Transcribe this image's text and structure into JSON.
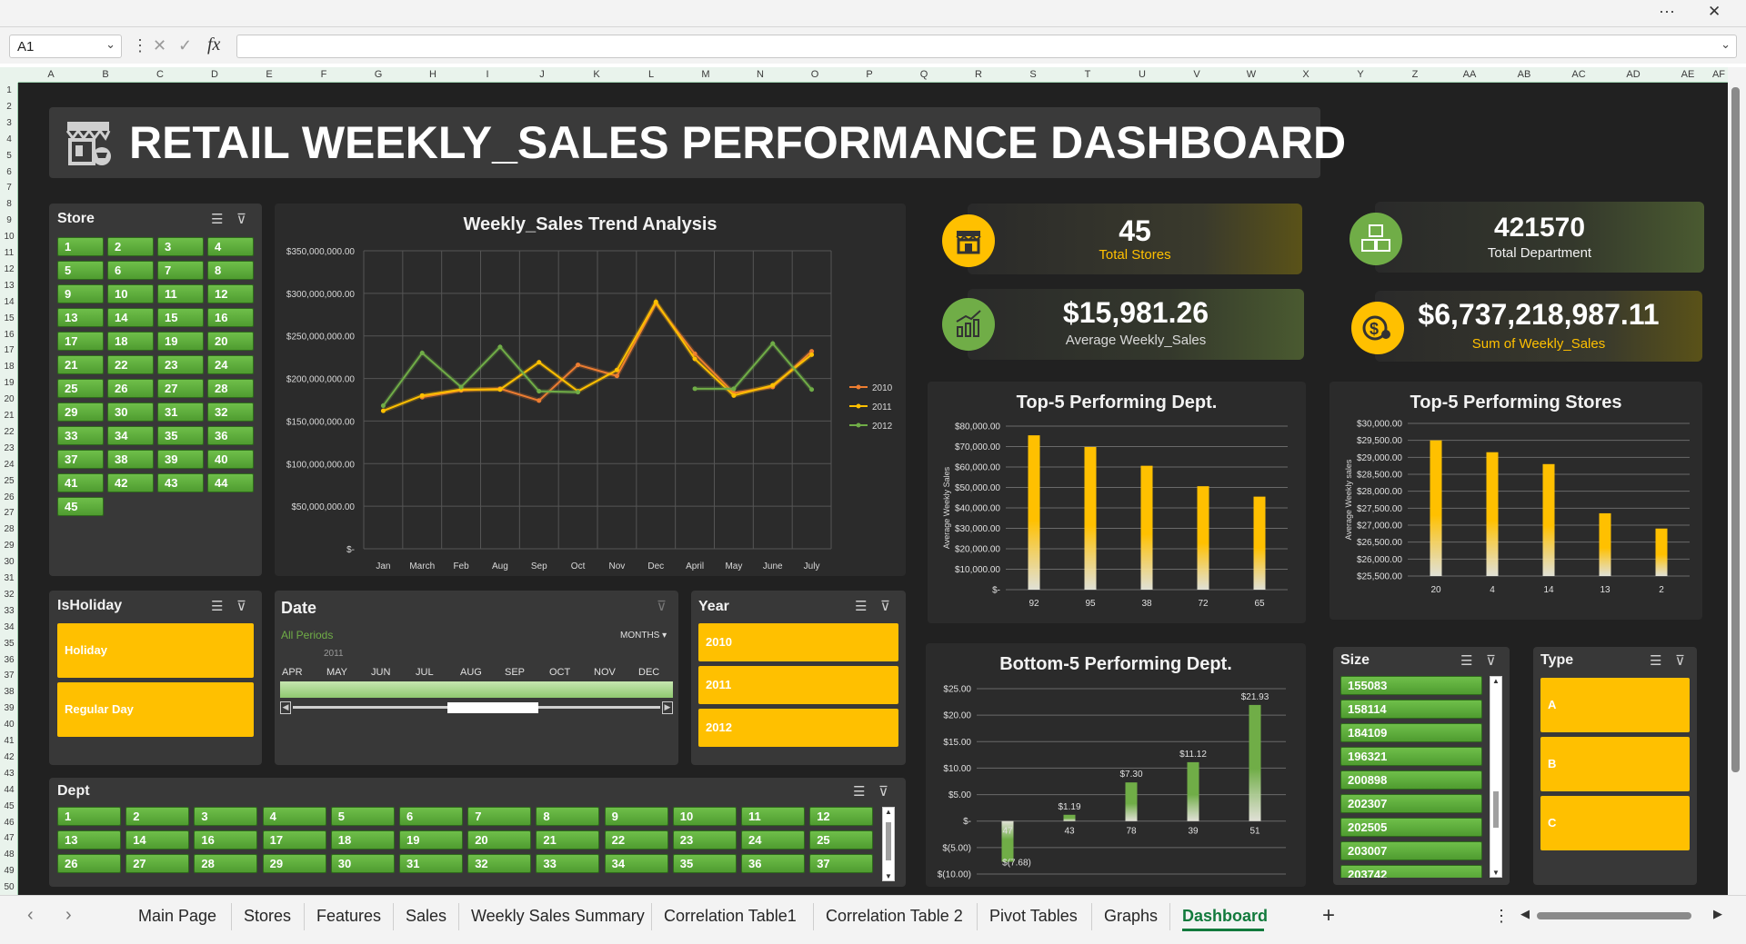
{
  "window": {
    "more_label": "···",
    "close_label": "✕"
  },
  "formula": {
    "cell_ref": "A1",
    "cancel_label": "✕",
    "enter_label": "✓",
    "fx_label": "fx",
    "value": ""
  },
  "columns": [
    "A",
    "B",
    "C",
    "D",
    "E",
    "F",
    "G",
    "H",
    "I",
    "J",
    "K",
    "L",
    "M",
    "N",
    "O",
    "P",
    "Q",
    "R",
    "S",
    "T",
    "U",
    "V",
    "W",
    "X",
    "Y",
    "Z",
    "AA",
    "AB",
    "AC",
    "AD",
    "AE",
    "AF"
  ],
  "rows": [
    "1",
    "2",
    "3",
    "4",
    "5",
    "6",
    "7",
    "8",
    "9",
    "10",
    "11",
    "12",
    "13",
    "14",
    "15",
    "16",
    "17",
    "18",
    "19",
    "20",
    "21",
    "22",
    "23",
    "24",
    "25",
    "26",
    "27",
    "28",
    "29",
    "30",
    "31",
    "32",
    "33",
    "34",
    "35",
    "36",
    "37",
    "38",
    "39",
    "40",
    "41",
    "42",
    "43",
    "44",
    "45",
    "46",
    "47",
    "48",
    "49",
    "50"
  ],
  "dashboard": {
    "title": "RETAIL WEEKLY_SALES PERFORMANCE DASHBOARD",
    "kpis": [
      {
        "value": "45",
        "label": "Total Stores",
        "label_color": "#ffc000"
      },
      {
        "value": "421570",
        "label": "Total Department",
        "label_color": "#f2f2f2"
      },
      {
        "value": "$15,981.26",
        "label": "Average Weekly_Sales",
        "label_color": "#d9d9d9"
      },
      {
        "value": "$6,737,218,987.11",
        "label": "Sum of Weekly_Sales",
        "label_color": "#ffc000"
      }
    ],
    "store_slicer": {
      "title": "Store",
      "items": [
        "1",
        "2",
        "3",
        "4",
        "5",
        "6",
        "7",
        "8",
        "9",
        "10",
        "11",
        "12",
        "13",
        "14",
        "15",
        "16",
        "17",
        "18",
        "19",
        "20",
        "21",
        "22",
        "23",
        "24",
        "25",
        "26",
        "27",
        "28",
        "29",
        "30",
        "31",
        "32",
        "33",
        "34",
        "35",
        "36",
        "37",
        "38",
        "39",
        "40",
        "41",
        "42",
        "43",
        "44",
        "45"
      ]
    },
    "holiday_slicer": {
      "title": "IsHoliday",
      "items": [
        "Holiday",
        "Regular Day"
      ]
    },
    "date_timeline": {
      "title": "Date",
      "range_label": "All Periods",
      "level_label": "MONTHS",
      "year_label": "2011",
      "months": [
        "APR",
        "MAY",
        "JUN",
        "JUL",
        "AUG",
        "SEP",
        "OCT",
        "NOV",
        "DEC"
      ]
    },
    "year_slicer": {
      "title": "Year",
      "items": [
        "2010",
        "2011",
        "2012"
      ]
    },
    "dept_slicer": {
      "title": "Dept",
      "items": [
        "1",
        "2",
        "3",
        "4",
        "5",
        "6",
        "7",
        "8",
        "9",
        "10",
        "11",
        "12",
        "13",
        "14",
        "16",
        "17",
        "18",
        "19",
        "20",
        "21",
        "22",
        "23",
        "24",
        "25",
        "26",
        "27",
        "28",
        "29",
        "30",
        "31",
        "32",
        "33",
        "34",
        "35",
        "36",
        "37"
      ]
    },
    "size_slicer": {
      "title": "Size",
      "items": [
        "155083",
        "158114",
        "184109",
        "196321",
        "200898",
        "202307",
        "202505",
        "203007",
        "203742"
      ]
    },
    "type_slicer": {
      "title": "Type",
      "items": [
        "A",
        "B",
        "C"
      ]
    }
  },
  "chart_data": [
    {
      "type": "line",
      "title": "Weekly_Sales Trend Analysis",
      "categories": [
        "Jan",
        "March",
        "Feb",
        "Aug",
        "Sep",
        "Oct",
        "Nov",
        "Dec",
        "April",
        "May",
        "June",
        "July"
      ],
      "y_ticks": [
        "$-",
        "$50,000,000.00",
        "$100,000,000.00",
        "$150,000,000.00",
        "$200,000,000.00",
        "$250,000,000.00",
        "$300,000,000.00",
        "$350,000,000.00"
      ],
      "ylim": [
        0,
        350000000
      ],
      "legend_position": "right",
      "series": [
        {
          "name": "2010",
          "color": "#ed7d31",
          "values": [
            null,
            178000000,
            186000000,
            188000000,
            174000000,
            216000000,
            203000000,
            288000000,
            229000000,
            183000000,
            190000000,
            232000000
          ]
        },
        {
          "name": "2011",
          "color": "#ffc000",
          "values": [
            162000000,
            180000000,
            187000000,
            187000000,
            219000000,
            185000000,
            210000000,
            290000000,
            223000000,
            180000000,
            192000000,
            228000000
          ]
        },
        {
          "name": "2012",
          "color": "#70ad47",
          "values": [
            168000000,
            230000000,
            190000000,
            237000000,
            185000000,
            184000000,
            null,
            null,
            188000000,
            188000000,
            241000000,
            187000000
          ]
        }
      ]
    },
    {
      "type": "bar",
      "title": "Top-5 Performing Dept.",
      "ylabel": "Average Weekly Sales",
      "categories": [
        "92",
        "95",
        "38",
        "72",
        "65"
      ],
      "values": [
        75500,
        69800,
        60600,
        50600,
        45500
      ],
      "y_ticks": [
        "$-",
        "$10,000.00",
        "$20,000.00",
        "$30,000.00",
        "$40,000.00",
        "$50,000.00",
        "$60,000.00",
        "$70,000.00",
        "$80,000.00"
      ],
      "ylim": [
        0,
        80000
      ],
      "color": "#ffc000"
    },
    {
      "type": "bar",
      "title": "Top-5 Performing Stores",
      "ylabel": "Average Weekly sales",
      "categories": [
        "20",
        "4",
        "14",
        "13",
        "2"
      ],
      "values": [
        29500,
        29150,
        28800,
        27350,
        26900
      ],
      "y_ticks": [
        "$25,500.00",
        "$26,000.00",
        "$26,500.00",
        "$27,000.00",
        "$27,500.00",
        "$28,000.00",
        "$28,500.00",
        "$29,000.00",
        "$29,500.00",
        "$30,000.00"
      ],
      "ylim": [
        25500,
        30000
      ],
      "color": "#ffc000"
    },
    {
      "type": "bar",
      "title": "Bottom-5 Performing Dept.",
      "categories": [
        "47",
        "43",
        "78",
        "39",
        "51"
      ],
      "values": [
        -7.68,
        1.19,
        7.3,
        11.12,
        21.93
      ],
      "data_labels": [
        "$(7.68)",
        "$1.19",
        "$7.30",
        "$11.12",
        "$21.93"
      ],
      "y_ticks": [
        "$(10.00)",
        "$(5.00)",
        "$-",
        "$5.00",
        "$10.00",
        "$15.00",
        "$20.00",
        "$25.00"
      ],
      "ylim": [
        -10,
        25
      ],
      "color": "#70ad47"
    }
  ],
  "sheet_tabs": [
    "Main Page",
    "Stores",
    "Features",
    "Sales",
    "Weekly Sales Summary",
    "Correlation Table1",
    "Correlation Table 2",
    "Pivot Tables",
    "Graphs",
    "Dashboard"
  ],
  "active_tab": "Dashboard",
  "tab_controls": {
    "prev": "‹",
    "next": "›",
    "add": "+",
    "more": "⋮"
  }
}
